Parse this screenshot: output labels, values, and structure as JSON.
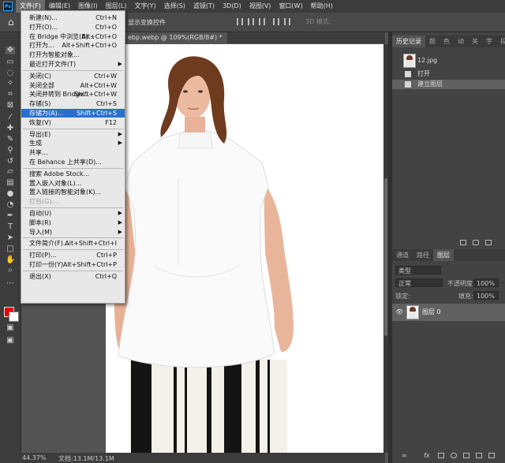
{
  "menubar": {
    "logo": "Ps",
    "items": [
      "文件(F)",
      "编辑(E)",
      "图像(I)",
      "图层(L)",
      "文字(Y)",
      "选择(S)",
      "滤镜(T)",
      "3D(D)",
      "视图(V)",
      "窗口(W)",
      "帮助(H)"
    ],
    "active_index": 0
  },
  "options_bar": {
    "transform_label": "显示变换控件",
    "mode_3d_label": "3D 模式:"
  },
  "document_tab": {
    "title": "ebp.webp @ 109%(RGB/8#) *"
  },
  "file_menu": [
    {
      "label": "新建(N)...",
      "shortcut": "Ctrl+N"
    },
    {
      "label": "打开(O)...",
      "shortcut": "Ctrl+O"
    },
    {
      "label": "在 Bridge 中浏览(B)...",
      "shortcut": "Alt+Ctrl+O"
    },
    {
      "label": "打开为...",
      "shortcut": "Alt+Shift+Ctrl+O"
    },
    {
      "label": "打开为智能对象..."
    },
    {
      "label": "最近打开文件(T)",
      "submenu": true
    },
    {
      "separator": true
    },
    {
      "label": "关闭(C)",
      "shortcut": "Ctrl+W"
    },
    {
      "label": "关闭全部",
      "shortcut": "Alt+Ctrl+W"
    },
    {
      "label": "关闭并转到 Bridge...",
      "shortcut": "Shift+Ctrl+W"
    },
    {
      "label": "存储(S)",
      "shortcut": "Ctrl+S"
    },
    {
      "label": "存储为(A)...",
      "shortcut": "Shift+Ctrl+S",
      "highlighted": true
    },
    {
      "label": "恢复(V)",
      "shortcut": "F12"
    },
    {
      "separator": true
    },
    {
      "label": "导出(E)",
      "submenu": true
    },
    {
      "label": "生成",
      "submenu": true
    },
    {
      "label": "共享..."
    },
    {
      "label": "在 Behance 上共享(D)..."
    },
    {
      "separator": true
    },
    {
      "label": "搜索 Adobe Stock..."
    },
    {
      "label": "置入嵌入对象(L)..."
    },
    {
      "label": "置入链接的智能对象(K)..."
    },
    {
      "label": "打包(G)...",
      "disabled": true
    },
    {
      "separator": true
    },
    {
      "label": "自动(U)",
      "submenu": true
    },
    {
      "label": "脚本(R)",
      "submenu": true
    },
    {
      "label": "导入(M)",
      "submenu": true
    },
    {
      "separator": true
    },
    {
      "label": "文件简介(F)...",
      "shortcut": "Alt+Shift+Ctrl+I"
    },
    {
      "separator": true
    },
    {
      "label": "打印(P)...",
      "shortcut": "Ctrl+P"
    },
    {
      "label": "打印一份(Y)",
      "shortcut": "Alt+Shift+Ctrl+P"
    },
    {
      "separator": true
    },
    {
      "label": "退出(X)",
      "shortcut": "Ctrl+Q"
    }
  ],
  "history_panel": {
    "tabs": [
      "历史记录",
      "颜",
      "色",
      "动",
      "关",
      "字",
      "段"
    ],
    "snapshot_name": "12.jpg",
    "steps": [
      {
        "label": "打开",
        "selected": false
      },
      {
        "label": "建立图层",
        "selected": true
      }
    ]
  },
  "layers_panel": {
    "tabs": [
      "通道",
      "路径",
      "图层"
    ],
    "active_tab": 2,
    "filter_kind": "类型",
    "blend_mode": "正常",
    "opacity_label": "不透明度:",
    "opacity_value": "100%",
    "lock_label": "锁定:",
    "fill_label": "填充:",
    "fill_value": "100%",
    "layers": [
      {
        "name": "图层 0",
        "visible": true
      }
    ]
  },
  "status_bar": {
    "zoom": "44.37%",
    "doc_info": "文档:13.1M/13.1M"
  },
  "colors": {
    "foreground": "#e60000",
    "background": "#ffffff",
    "highlight": "#2b6fce"
  },
  "icons": [
    "home-icon",
    "move-icon",
    "marquee-icon",
    "lasso-icon",
    "magic-wand-icon",
    "crop-icon",
    "frame-icon",
    "eyedropper-icon",
    "healing-brush-icon",
    "brush-icon",
    "clone-stamp-icon",
    "history-brush-icon",
    "eraser-icon",
    "gradient-icon",
    "blur-icon",
    "dodge-icon",
    "pen-icon",
    "type-icon",
    "path-selection-icon",
    "rectangle-icon",
    "hand-icon",
    "zoom-icon",
    "more-tools-icon",
    "eye-icon",
    "link-icon",
    "fx-icon",
    "mask-icon",
    "adjustment-icon",
    "folder-icon",
    "new-layer-icon",
    "trash-icon",
    "camera-icon"
  ]
}
